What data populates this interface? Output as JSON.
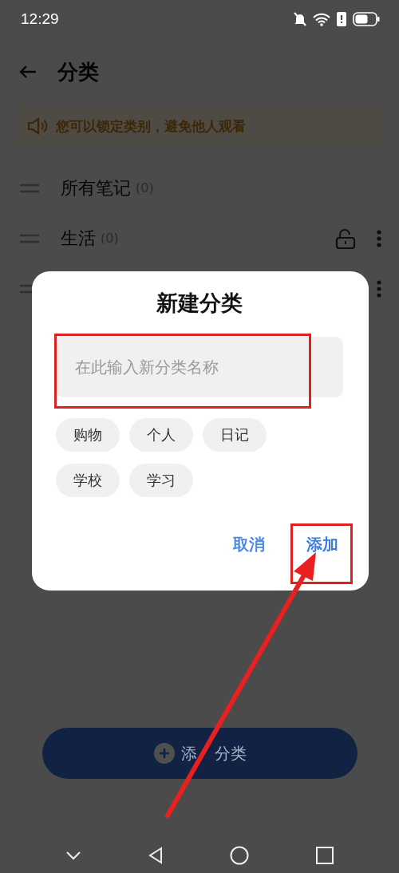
{
  "status_bar": {
    "time": "12:29"
  },
  "header": {
    "title": "分类"
  },
  "notice": {
    "text": "您可以锁定类别，避免他人观看"
  },
  "categories": [
    {
      "label": "所有笔记",
      "count": "(0)"
    },
    {
      "label": "生活",
      "count": "(0)",
      "actions": [
        {
          "kind": "lock"
        },
        {
          "kind": "more"
        }
      ]
    },
    {
      "actions": [
        {
          "kind": "more"
        }
      ]
    }
  ],
  "add_button": {
    "label_parts": [
      "添",
      "分类"
    ]
  },
  "dialog": {
    "title": "新建分类",
    "input": {
      "placeholder": "在此输入新分类名称"
    },
    "suggestions": [
      {
        "label": "购物"
      },
      {
        "label": "个人"
      },
      {
        "label": "日记"
      },
      {
        "label": "学校"
      },
      {
        "label": "学习"
      }
    ],
    "buttons": [
      {
        "label": "取消",
        "highlighted": false
      },
      {
        "label": "添加",
        "highlighted": true
      }
    ]
  }
}
